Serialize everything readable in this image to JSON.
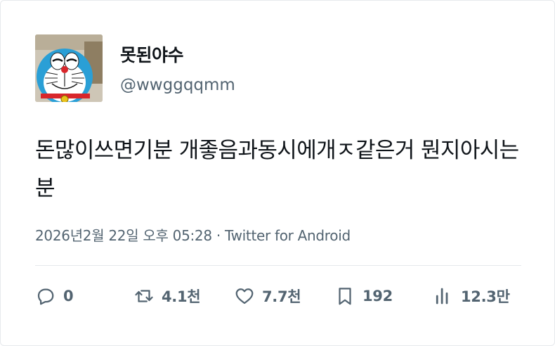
{
  "user": {
    "display_name": "못된야수",
    "handle": "@wwggqqmm"
  },
  "tweet": {
    "text": "돈많이쓰면기분 개좋음과동시에개ㅈ같은거 뭔지아시는분",
    "date": "2026년2월 22일 오후 05:28",
    "separator": "·",
    "source": "Twitter for Android"
  },
  "actions": {
    "replies": "0",
    "retweets": "4.1천",
    "likes": "7.7천",
    "bookmarks": "192",
    "views": "12.3만"
  },
  "icons": {
    "reply": "speech-bubble-icon",
    "retweet": "retweet-arrows-icon",
    "like": "heart-icon",
    "bookmark": "bookmark-icon",
    "views": "bar-chart-icon"
  },
  "colors": {
    "text": "#0f1419",
    "secondary": "#536471",
    "border": "#e6e9ec"
  }
}
